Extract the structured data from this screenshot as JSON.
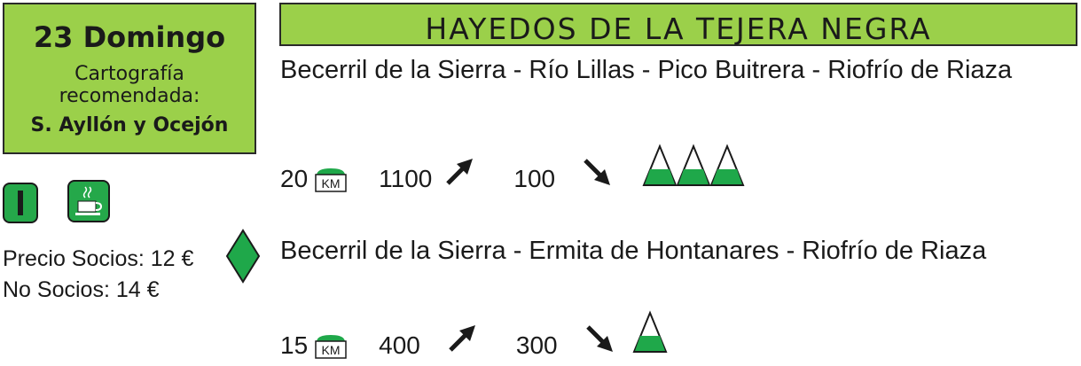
{
  "date_box": {
    "day": "23 Domingo",
    "cartography_label": "Cartografía recomendada:",
    "map_name": "S. Ayllón y Ocejón"
  },
  "title": "HAYEDOS DE LA TEJERA NEGRA",
  "routes": [
    {
      "name": "Becerril de la Sierra - Río Lillas - Pico Buitrera - Riofrío de Riaza",
      "distance": "20",
      "distance_unit": "KM",
      "ascent": "1100",
      "descent": "100",
      "difficulty_level": 3
    },
    {
      "name": "Becerril de la Sierra - Ermita de Hontanares - Riofrío de Riaza",
      "distance": "15",
      "distance_unit": "KM",
      "ascent": "400",
      "descent": "300",
      "difficulty_level": 1
    }
  ],
  "prices": {
    "members": "Precio Socios: 12 €",
    "non_members": "No Socios: 14 €"
  },
  "icons": [
    "level-i-icon",
    "coffee-cup-icon",
    "green-diamond-icon"
  ],
  "colors": {
    "accent_green": "#9bd04a",
    "icon_green": "#25a84a",
    "mountain_green": "#1fa84a"
  }
}
